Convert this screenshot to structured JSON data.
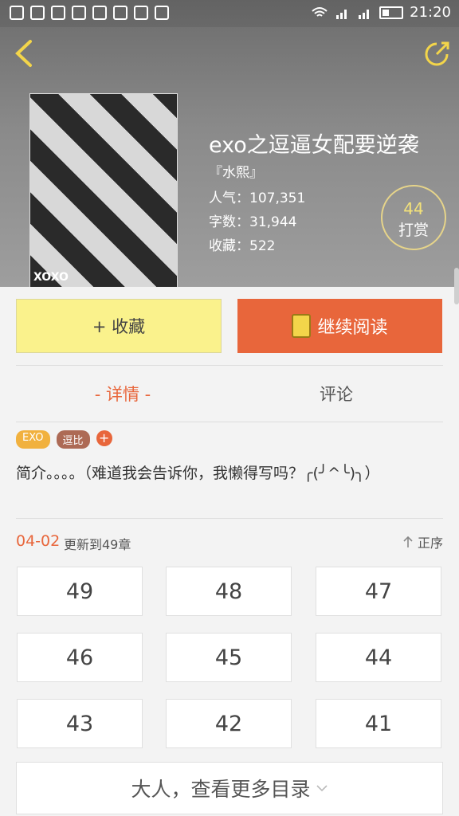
{
  "status_bar": {
    "time": "21:20"
  },
  "book": {
    "title": "exo之逗逼女配要逆袭",
    "author": "『水熙』",
    "popularity_label": "人气：",
    "popularity_value": "107,351",
    "word_count_label": "字数：",
    "word_count_value": "31,944",
    "favorites_label": "收藏：",
    "favorites_value": "522",
    "tip_count": "44",
    "tip_label": "打赏",
    "cover_text": "XOXO"
  },
  "actions": {
    "collect_label": "+ 收藏",
    "read_label": "继续阅读"
  },
  "tabs": [
    {
      "label": "- 详情 -"
    },
    {
      "label": "评论"
    }
  ],
  "tags": [
    {
      "label": "EXO"
    },
    {
      "label": "逗比"
    },
    {
      "label": "+"
    }
  ],
  "intro": "简介。。。。（难道我会告诉你，我懒得写吗？╭(╯^╰)╮）",
  "updates": {
    "date": "04-02",
    "text": "更新到49章",
    "order_label": "正序"
  },
  "chapters": [
    "49",
    "48",
    "47",
    "46",
    "45",
    "44",
    "43",
    "42",
    "41"
  ],
  "more_label": "大人，查看更多目录",
  "colors": {
    "accent": "#e8663b",
    "collect_bg": "#faf28c",
    "tip_number": "#f3e27a"
  }
}
